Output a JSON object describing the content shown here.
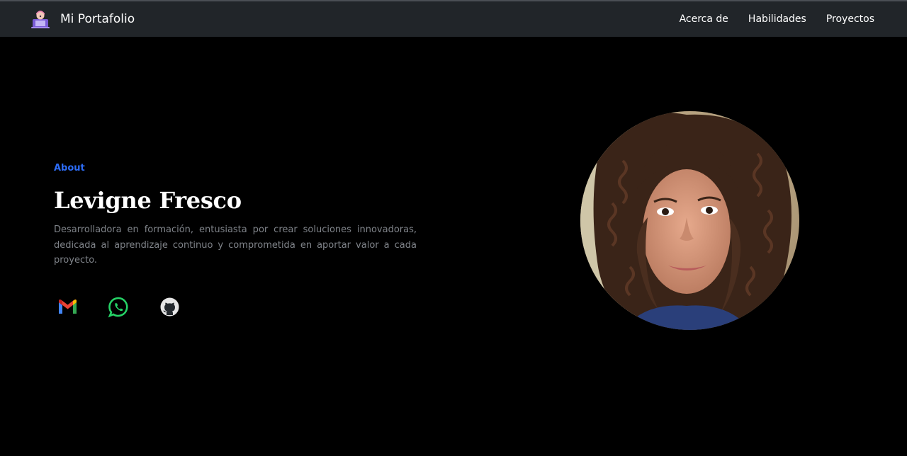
{
  "navbar": {
    "brand": "Mi Portafolio",
    "brand_icon": "developer-avatar-icon",
    "links": [
      "Acerca de",
      "Habilidades",
      "Proyectos"
    ]
  },
  "hero": {
    "label": "About",
    "name": "Levigne Fresco",
    "description": "Desarrolladora en formación, entusiasta por crear soluciones innovadoras, dedicada al aprendizaje continuo y comprometida en aportar valor a cada proyecto."
  },
  "social": {
    "icons": [
      "gmail-icon",
      "whatsapp-icon",
      "github-icon"
    ]
  },
  "colors": {
    "navbar_bg": "#212529",
    "page_bg": "#000000",
    "accent": "#2d6cf5",
    "muted_text": "#7f8389"
  }
}
